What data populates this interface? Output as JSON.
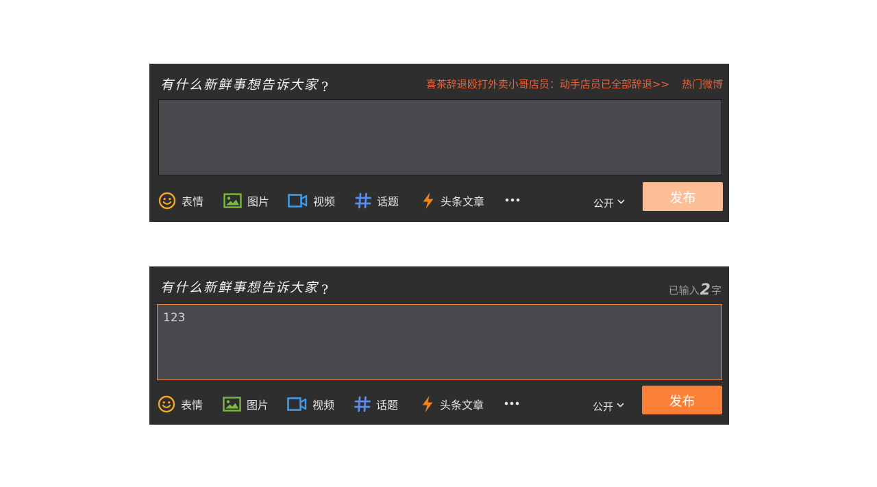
{
  "composer_empty": {
    "prompt": "有什么新鲜事想告诉大家",
    "prompt_mark": "?",
    "hot_headline": "喜茶辞退殴打外卖小哥店员：动手店员已全部辞退>>",
    "hot_link": "热门微博",
    "input_value": "",
    "toolbar": {
      "emoji_label": "表情",
      "image_label": "图片",
      "video_label": "视频",
      "topic_label": "话题",
      "article_label": "头条文章",
      "visibility_label": "公开",
      "publish_label": "发布"
    },
    "publish_enabled": false
  },
  "composer_typing": {
    "prompt": "有什么新鲜事想告诉大家",
    "prompt_mark": "?",
    "count_prefix": "已输入",
    "count_value": "2",
    "count_suffix": "字",
    "input_value": "123",
    "toolbar": {
      "emoji_label": "表情",
      "image_label": "图片",
      "video_label": "视频",
      "topic_label": "话题",
      "article_label": "头条文章",
      "visibility_label": "公开",
      "publish_label": "发布"
    },
    "publish_enabled": true
  },
  "colors": {
    "panel_bg": "#2e2e2e",
    "input_bg": "#4a4a4e",
    "accent_orange": "#fb7f36",
    "disabled_orange": "#fdbe97",
    "hot_text": "#e8613a",
    "focus_border": "#ee7e3a",
    "emoji_icon": "#f5a623",
    "image_icon": "#7cb93e",
    "video_icon": "#3f9ae8",
    "topic_icon": "#5b8def",
    "article_icon": "#f2821f"
  },
  "icons": [
    "smiley-icon",
    "picture-icon",
    "video-camera-icon",
    "hashtag-icon",
    "lightning-icon",
    "more-dots-icon",
    "chevron-down-icon"
  ]
}
